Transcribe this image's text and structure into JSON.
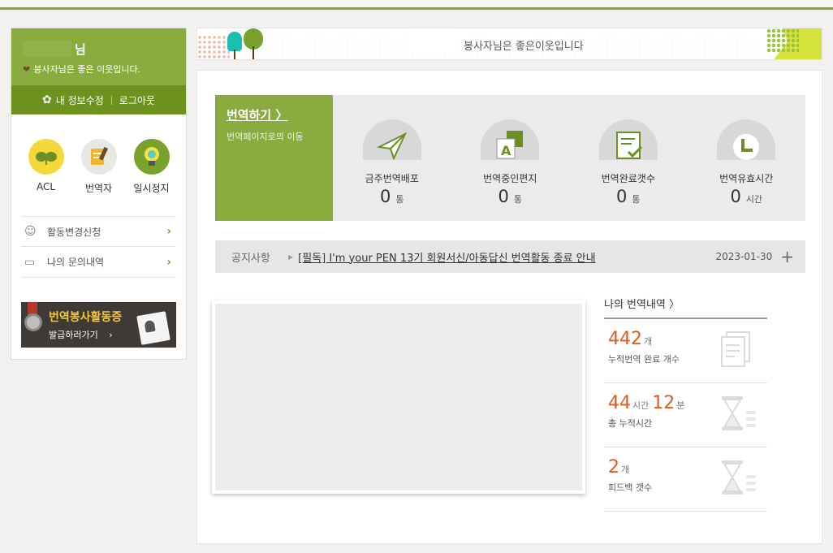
{
  "sidebar": {
    "name_suffix": "님",
    "greeting": "봉사자님은 좋은 이웃입니다.",
    "edit_info": "내 정보수정",
    "logout": "로그아웃",
    "icons": [
      {
        "label": "ACL",
        "icon": "sprout-icon"
      },
      {
        "label": "번역자",
        "icon": "document-pencil-icon"
      },
      {
        "label": "일시정지",
        "icon": "lightbulb-icon"
      }
    ],
    "menu": [
      {
        "label": "활동변경신청",
        "icon": "smiley-icon"
      },
      {
        "label": "나의 문의내역",
        "icon": "chat-icon"
      }
    ],
    "banner": {
      "title": "번역봉사활동증",
      "subtitle": "발급하러가기"
    }
  },
  "greetbar": {
    "text": "봉사자님은 좋은이웃입니다"
  },
  "stats": {
    "lead_title": "번역하기 〉",
    "lead_sub": "번역페이지로의 이동",
    "items": [
      {
        "label": "금주번역배포",
        "value": "0",
        "unit": "통",
        "icon": "paper-plane-icon"
      },
      {
        "label": "번역중인편지",
        "value": "0",
        "unit": "통",
        "icon": "letter-a-icon"
      },
      {
        "label": "번역완료갯수",
        "value": "0",
        "unit": "통",
        "icon": "document-check-icon"
      },
      {
        "label": "번역유효시간",
        "value": "0",
        "unit": "시간",
        "icon": "clock-icon"
      }
    ]
  },
  "notice": {
    "label": "공지사항",
    "link": "[필독] I'm your PEN 13기 회원서신/아동답신 번역활동 종료 안내",
    "date": "2023-01-30",
    "more": "+"
  },
  "history": {
    "title": "나의 번역내역 〉",
    "completed": {
      "num": "442",
      "unit": "개",
      "desc": "누적번역 완료 개수"
    },
    "time": {
      "hours": "44",
      "hours_unit": "시간",
      "minutes": "12",
      "minutes_unit": "분",
      "desc": "총 누적시간"
    },
    "feedback": {
      "num": "2",
      "unit": "개",
      "desc": "피드백 갯수"
    }
  }
}
